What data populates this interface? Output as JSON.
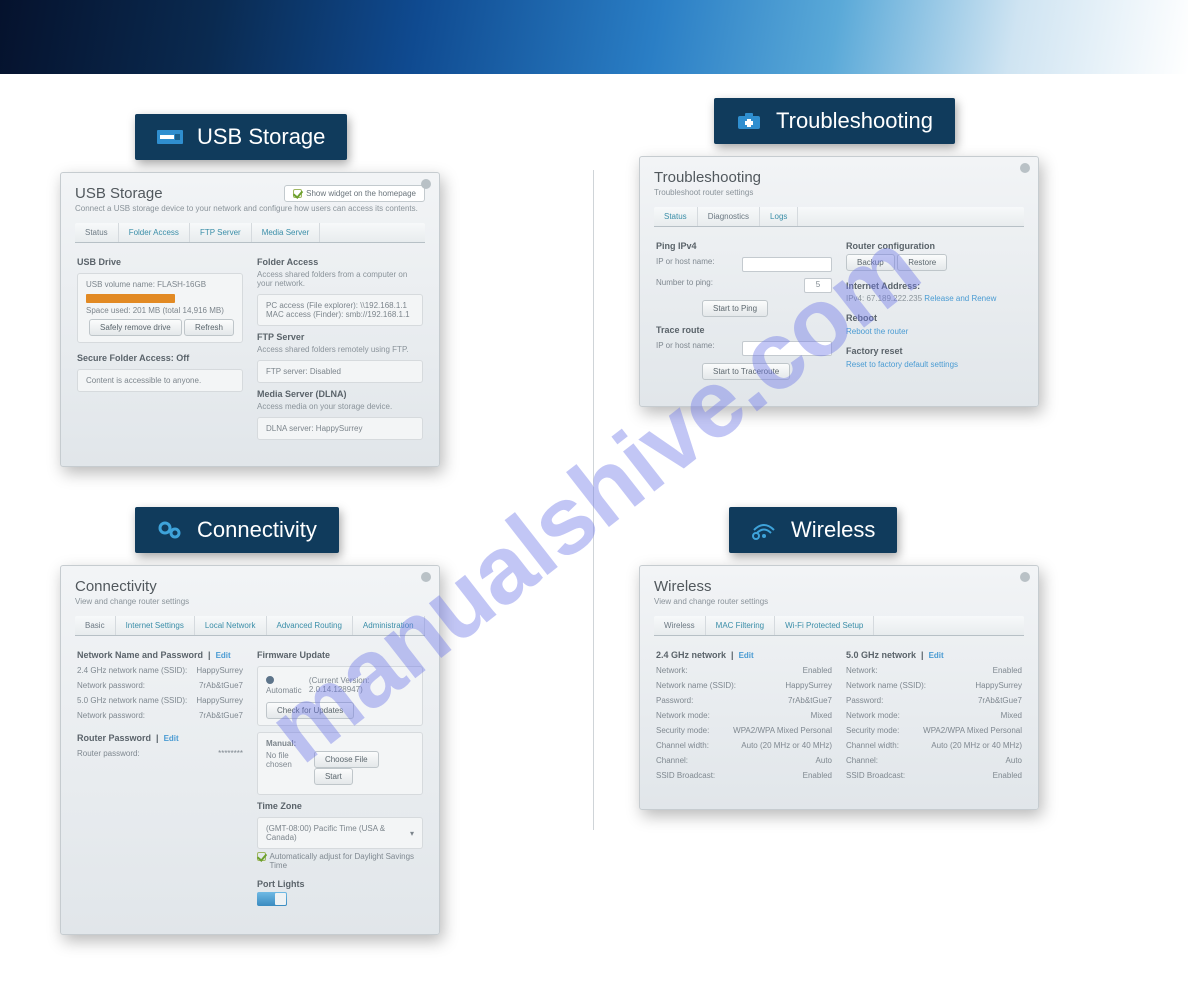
{
  "watermark": "manualshive.com",
  "left_top": {
    "label": "USB Storage",
    "title": "USB Storage",
    "subtitle": "Connect a USB storage device to your network and configure how users can access its contents.",
    "homepage_badge": "Show widget on the homepage",
    "tabs": [
      "Status",
      "Folder Access",
      "FTP Server",
      "Media Server"
    ],
    "usb_drive_title": "USB Drive",
    "usb_volume": "USB volume name: FLASH-16GB",
    "usb_space": "Space used: 201 MB (total 14,916 MB)",
    "btn_safely": "Safely remove drive",
    "btn_refresh": "Refresh",
    "secure_title": "Secure Folder Access: Off",
    "secure_sub": "Content is accessible to anyone.",
    "folder_access_title": "Folder Access",
    "folder_access_sub": "Access shared folders from a computer on your network.",
    "folder_pc": "PC access (File explorer): \\\\192.168.1.1",
    "folder_mac": "MAC access (Finder): smb://192.168.1.1",
    "ftp_title": "FTP Server",
    "ftp_sub": "Access shared folders remotely using FTP.",
    "ftp_status": "FTP server: Disabled",
    "media_title": "Media Server (DLNA)",
    "media_sub": "Access media on your storage device.",
    "media_status": "DLNA server: HappySurrey"
  },
  "right_top": {
    "label": "Troubleshooting",
    "title": "Troubleshooting",
    "subtitle": "Troubleshoot router settings",
    "tabs": [
      "Status",
      "Diagnostics",
      "Logs"
    ],
    "ping_title": "Ping IPv4",
    "ping_ip_label": "IP or host name:",
    "ping_count_label": "Number to ping:",
    "ping_count_value": "5",
    "btn_ping": "Start to Ping",
    "trace_title": "Trace route",
    "trace_ip_label": "IP or host name:",
    "btn_trace": "Start to Traceroute",
    "router_cfg": "Router configuration",
    "btn_backup": "Backup",
    "btn_restore": "Restore",
    "inet_title": "Internet Address:",
    "inet_value": "IPv4: 67.189.222.235",
    "inet_link": "Release and Renew",
    "reboot_title": "Reboot",
    "reboot_link": "Reboot the router",
    "factory_title": "Factory reset",
    "factory_link": "Reset to factory default settings"
  },
  "left_bottom": {
    "label": "Connectivity",
    "title": "Connectivity",
    "subtitle": "View and change router settings",
    "tabs": [
      "Basic",
      "Internet Settings",
      "Local Network",
      "Advanced Routing",
      "Administration"
    ],
    "net_pw_title": "Network Name and Password",
    "edit": "Edit",
    "row1_l": "2.4 GHz network name (SSID):",
    "row1_r": "HappySurrey",
    "row2_l": "Network password:",
    "row2_r": "7rAb&tGue7",
    "row3_l": "5.0 GHz network name (SSID):",
    "row3_r": "HappySurrey",
    "row4_l": "Network password:",
    "row4_r": "7rAb&tGue7",
    "router_pw_title": "Router Password",
    "router_pw_label": "Router password:",
    "router_pw_value": "********",
    "fw_title": "Firmware Update",
    "fw_auto": "Automatic",
    "fw_current": "(Current Version: 2.0.14.128947)",
    "fw_check": "Check for Updates",
    "manual_title": "Manual:",
    "manual_sub": "No file chosen",
    "btn_choose": "Choose File",
    "btn_start": "Start",
    "tz_title": "Time Zone",
    "tz_value": "(GMT-08:00) Pacific Time (USA & Canada)",
    "tz_dst": "Automatically adjust for Daylight Savings Time",
    "port_title": "Port Lights",
    "port_on": "ON"
  },
  "right_bottom": {
    "label": "Wireless",
    "title": "Wireless",
    "subtitle": "View and change router settings",
    "tabs": [
      "Wireless",
      "MAC Filtering",
      "Wi-Fi Protected Setup"
    ],
    "g24_title": "2.4 GHz network",
    "g50_title": "5.0 GHz network",
    "edit": "Edit",
    "rows": [
      {
        "l": "Network:",
        "v24": "Enabled",
        "v50": "Enabled"
      },
      {
        "l": "Network name (SSID):",
        "v24": "HappySurrey",
        "v50": "HappySurrey"
      },
      {
        "l": "Password:",
        "v24": "7rAb&tGue7",
        "v50": "7rAb&tGue7"
      },
      {
        "l": "Network mode:",
        "v24": "Mixed",
        "v50": "Mixed"
      },
      {
        "l": "Security mode:",
        "v24": "WPA2/WPA Mixed Personal",
        "v50": "WPA2/WPA Mixed Personal"
      },
      {
        "l": "Channel width:",
        "v24": "Auto (20 MHz or 40 MHz)",
        "v50": "Auto (20 MHz or 40 MHz)"
      },
      {
        "l": "Channel:",
        "v24": "Auto",
        "v50": "Auto"
      },
      {
        "l": "SSID Broadcast:",
        "v24": "Enabled",
        "v50": "Enabled"
      }
    ]
  }
}
